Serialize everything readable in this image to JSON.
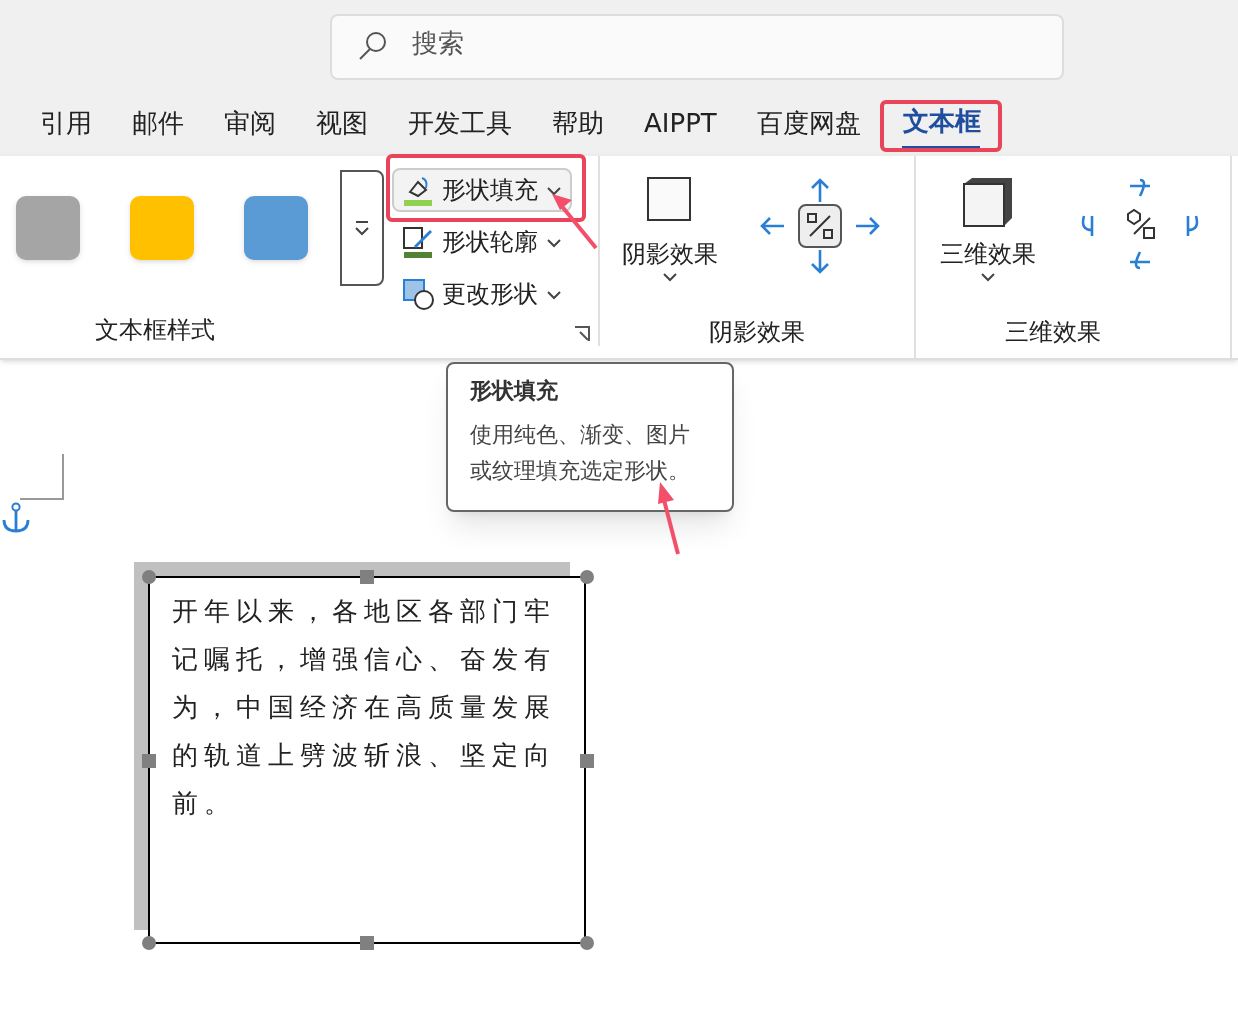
{
  "search": {
    "placeholder": "搜索"
  },
  "tabs": [
    {
      "label": "引用",
      "selected": false
    },
    {
      "label": "邮件",
      "selected": false
    },
    {
      "label": "审阅",
      "selected": false
    },
    {
      "label": "视图",
      "selected": false
    },
    {
      "label": "开发工具",
      "selected": false
    },
    {
      "label": "帮助",
      "selected": false
    },
    {
      "label": "AIPPT",
      "selected": false
    },
    {
      "label": "百度网盘",
      "selected": false
    },
    {
      "label": "文本框",
      "selected": true
    }
  ],
  "style_group": {
    "label": "文本框样式",
    "swatches": [
      {
        "color": "#a5a5a5"
      },
      {
        "color": "#ffc000"
      },
      {
        "color": "#5b9bd5"
      }
    ]
  },
  "shape_buttons": [
    {
      "kind": "fill",
      "label": "形状填充"
    },
    {
      "kind": "outline",
      "label": "形状轮廓"
    },
    {
      "kind": "change",
      "label": "更改形状"
    }
  ],
  "shadow_group": {
    "button": "阴影效果",
    "label": "阴影效果"
  },
  "three_d_group": {
    "button": "三维效果",
    "label": "三维效果"
  },
  "tooltip": {
    "title": "形状填充",
    "body": "使用纯色、渐变、图片或纹理填充选定形状。"
  },
  "text_box": {
    "text": "开年以来，各地区各部门牢记嘱托，增强信心、奋发有为，中国经济在高质量发展的轨道上劈波斩浪、坚定向前。"
  }
}
